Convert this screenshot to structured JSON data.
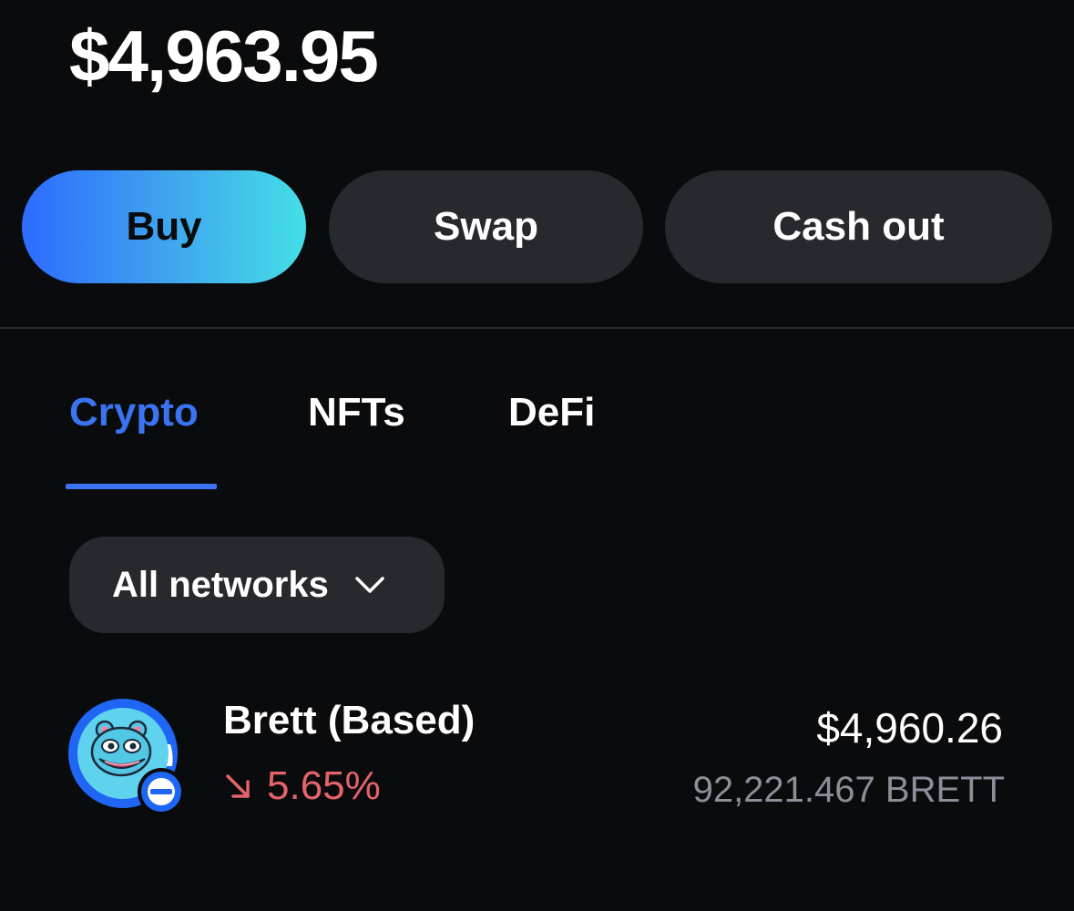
{
  "balance": "$4,963.95",
  "actions": {
    "buy": "Buy",
    "swap": "Swap",
    "cash_out": "Cash out"
  },
  "tabs": {
    "crypto": "Crypto",
    "nfts": "NFTs",
    "defi": "DeFi",
    "active": "Crypto"
  },
  "network_filter": {
    "label": "All networks",
    "icon": "chevron-down-icon"
  },
  "assets": [
    {
      "name": "Brett (Based)",
      "change": "5.65%",
      "change_direction": "down",
      "value": "$4,960.26",
      "quantity": "92,221.467 BRETT",
      "icon": "brett-token-icon",
      "network_badge": "base-network-icon"
    }
  ],
  "colors": {
    "background": "#0a0b0d",
    "accent": "#3b74f3",
    "button_bg": "#27292f",
    "negative": "#e5636b",
    "muted": "#8a9099"
  }
}
